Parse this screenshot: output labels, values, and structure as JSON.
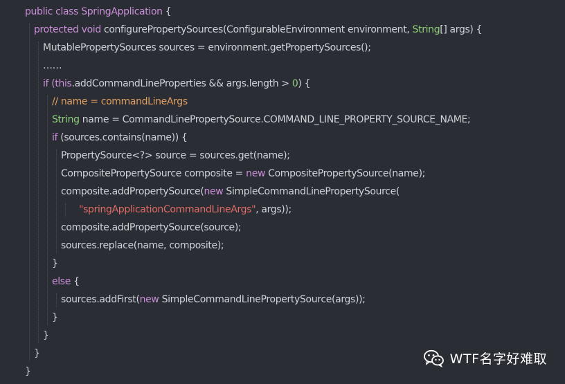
{
  "code_lines": [
    [
      {
        "t": "public class ",
        "c": "kw"
      },
      {
        "t": "SpringApplication",
        "c": "cls"
      },
      {
        "t": " {",
        "c": "plain"
      }
    ],
    [
      {
        "t": "protected void ",
        "c": "kw"
      },
      {
        "t": "configurePropertySources(ConfigurableEnvironment environment, ",
        "c": "plain"
      },
      {
        "t": "String",
        "c": "type"
      },
      {
        "t": "[] args) {",
        "c": "plain"
      }
    ],
    [
      {
        "t": "MutablePropertySources sources = environment.getPropertySources();",
        "c": "plain"
      }
    ],
    [
      {
        "t": "……",
        "c": "plain"
      }
    ],
    [
      {
        "t": "if (",
        "c": "kw"
      },
      {
        "t": "this",
        "c": "kw"
      },
      {
        "t": ".addCommandLineProperties && args.length > ",
        "c": "plain"
      },
      {
        "t": "0",
        "c": "num"
      },
      {
        "t": ") {",
        "c": "plain"
      }
    ],
    [
      {
        "t": "// name = commandLineArgs",
        "c": "cmt"
      }
    ],
    [
      {
        "t": "String",
        "c": "type"
      },
      {
        "t": " name = CommandLinePropertySource.COMMAND_LINE_PROPERTY_SOURCE_NAME;",
        "c": "plain"
      }
    ],
    [
      {
        "t": "if",
        "c": "kw"
      },
      {
        "t": " (sources.contains(name)) {",
        "c": "plain"
      }
    ],
    [
      {
        "t": "PropertySource<?> source = sources.get(name);",
        "c": "plain"
      }
    ],
    [
      {
        "t": "CompositePropertySource composite = ",
        "c": "plain"
      },
      {
        "t": "new",
        "c": "kw"
      },
      {
        "t": " CompositePropertySource(name);",
        "c": "plain"
      }
    ],
    [
      {
        "t": "composite.addPropertySource(",
        "c": "plain"
      },
      {
        "t": "new",
        "c": "kw"
      },
      {
        "t": " SimpleCommandLinePropertySource(",
        "c": "plain"
      }
    ],
    [
      {
        "t": "\"springApplicationCommandLineArgs\"",
        "c": "str"
      },
      {
        "t": ", args));",
        "c": "plain"
      }
    ],
    [
      {
        "t": "composite.addPropertySource(source);",
        "c": "plain"
      }
    ],
    [
      {
        "t": "sources.replace(name, composite);",
        "c": "plain"
      }
    ],
    [
      {
        "t": "}",
        "c": "plain"
      }
    ],
    [
      {
        "t": "else",
        "c": "kw"
      },
      {
        "t": " {",
        "c": "plain"
      }
    ],
    [
      {
        "t": "sources.addFirst(",
        "c": "plain"
      },
      {
        "t": "new",
        "c": "kw"
      },
      {
        "t": " SimpleCommandLinePropertySource(args));",
        "c": "plain"
      }
    ],
    [
      {
        "t": "}",
        "c": "plain"
      }
    ],
    [
      {
        "t": "}",
        "c": "plain"
      }
    ],
    [
      {
        "t": "}",
        "c": "plain"
      }
    ],
    [
      {
        "t": "}",
        "c": "plain"
      }
    ]
  ],
  "watermark": {
    "text": "WTF名字好难取",
    "icon": "wechat-icon"
  }
}
